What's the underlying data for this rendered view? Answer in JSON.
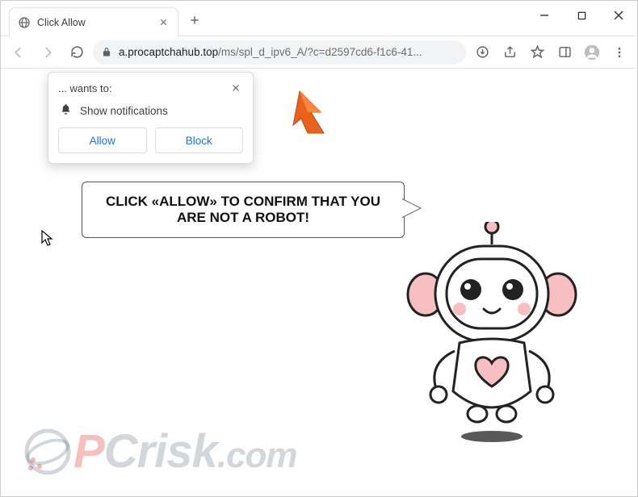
{
  "tab": {
    "title": "Click Allow"
  },
  "omnibox": {
    "host": "a.procaptchahub.top",
    "path": "/ms/spl_d_ipv6_A/?c=d2597cd6-f1c6-41..."
  },
  "permission_popup": {
    "title": "... wants to:",
    "item": "Show notifications",
    "allow": "Allow",
    "block": "Block"
  },
  "bubble": {
    "text": "CLICK «ALLOW» TO CONFIRM THAT YOU ARE NOT A ROBOT!"
  },
  "watermark": {
    "p": "P",
    "c": "C",
    "rest": "risk",
    "suffix": ".com"
  }
}
